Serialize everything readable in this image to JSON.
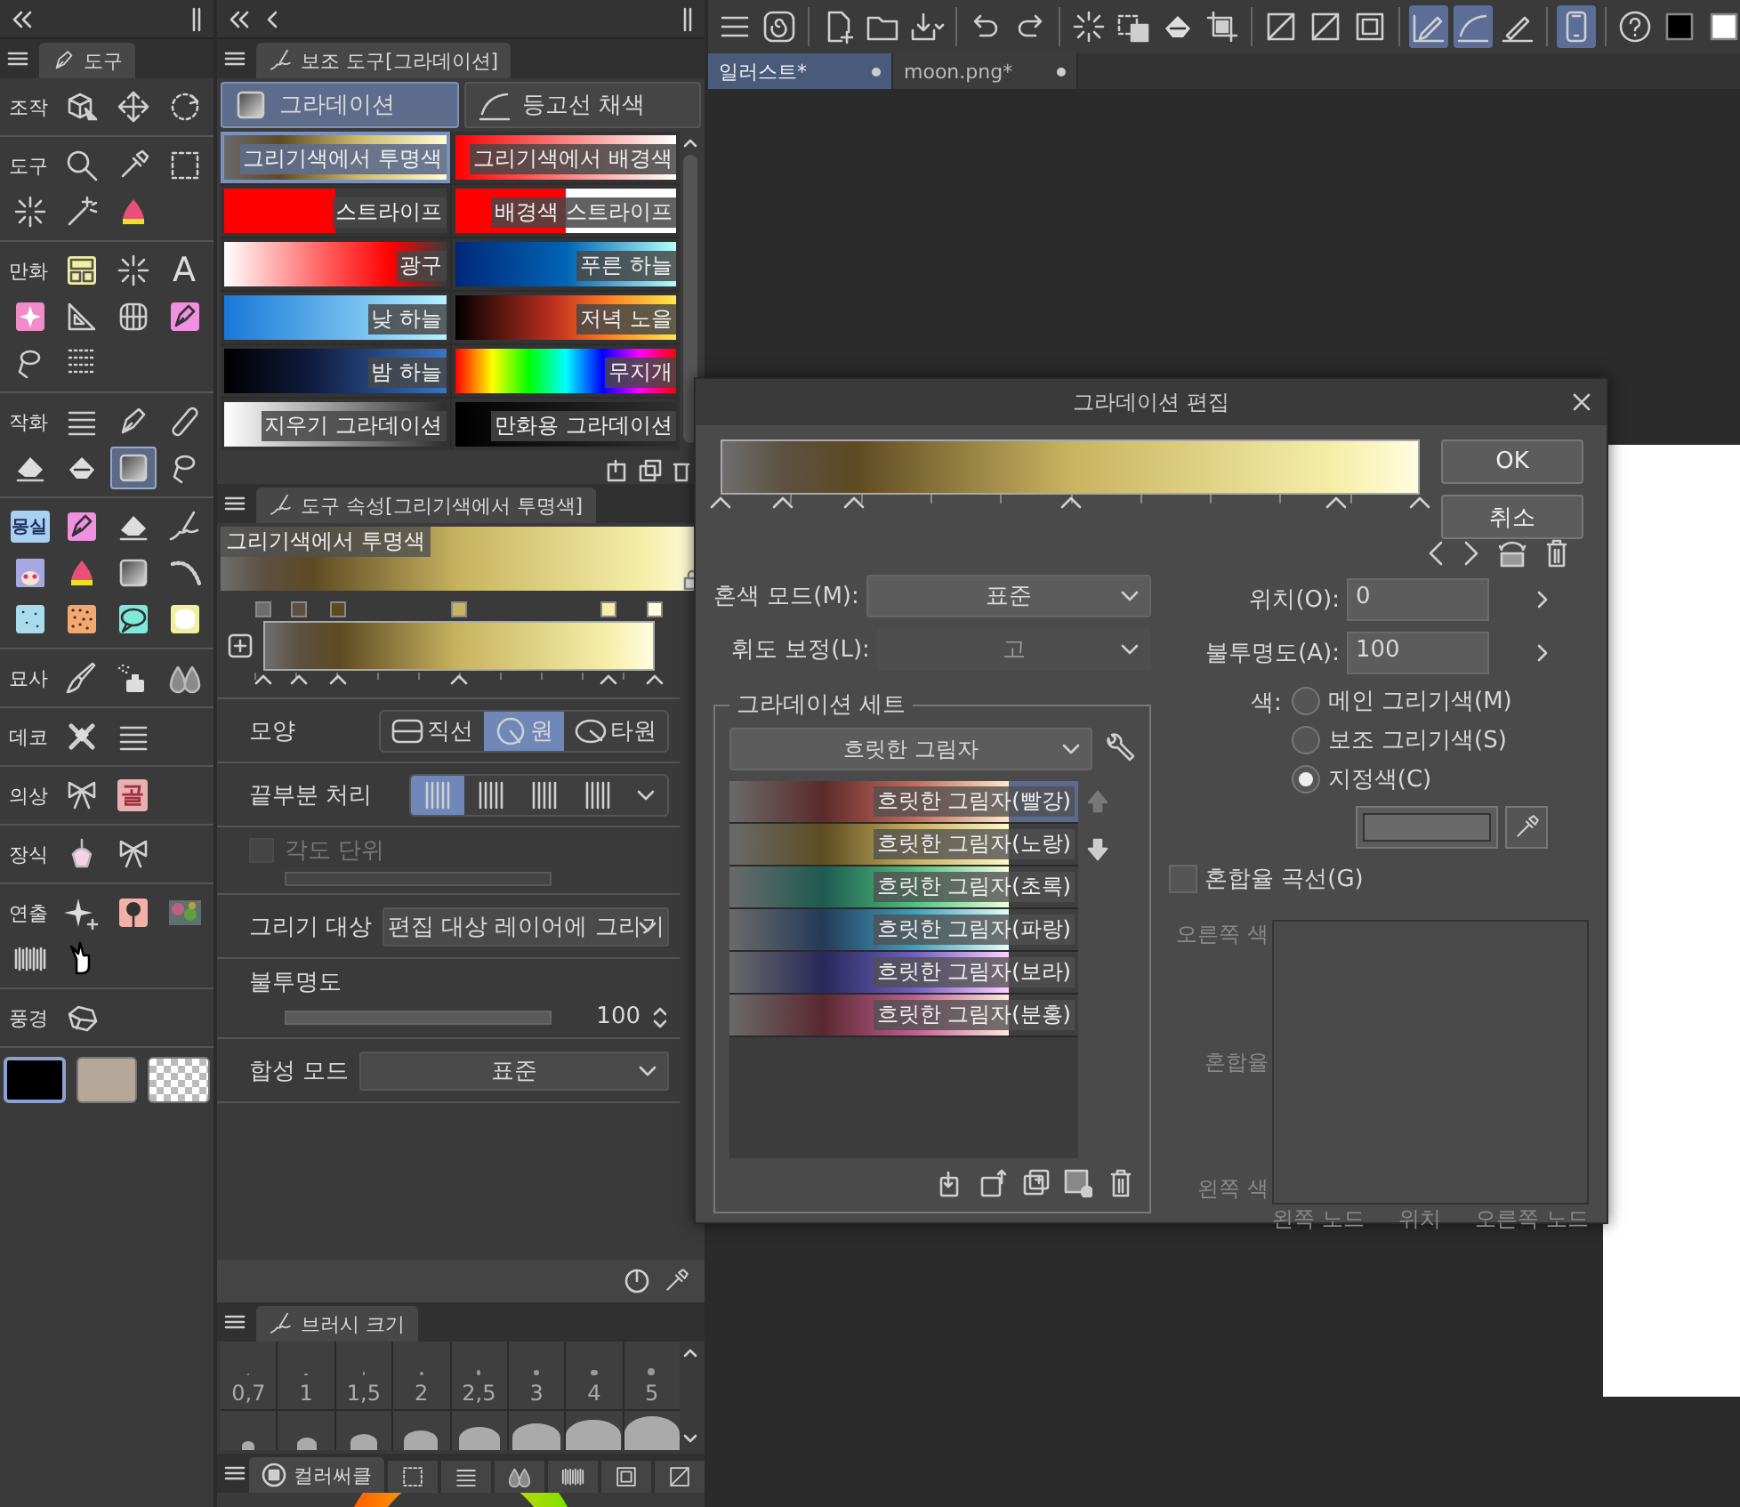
{
  "tool_palette": {
    "tab": "도구",
    "groups": [
      {
        "label": "조작",
        "tools": [
          {
            "selected": false
          },
          {
            "selected": false
          },
          {
            "selected": false
          }
        ]
      },
      {
        "label": "도구",
        "tools": [
          {
            "selected": false
          },
          {
            "selected": false
          },
          {
            "selected": false
          },
          {
            "selected": false
          },
          {
            "selected": false
          },
          {
            "selected": false
          }
        ]
      },
      {
        "label": "만화",
        "tools": [
          {
            "selected": false
          },
          {
            "selected": false
          },
          {
            "selected": false,
            "glyph": "A"
          },
          {
            "selected": false
          },
          {
            "selected": false
          },
          {
            "selected": false
          },
          {
            "selected": false
          },
          {
            "selected": false
          },
          {
            "selected": false
          }
        ]
      },
      {
        "label": "작화",
        "tools": [
          {
            "selected": false
          },
          {
            "selected": false
          },
          {
            "selected": false
          },
          {
            "selected": false
          },
          {
            "selected": false
          },
          {
            "selected": true
          },
          {
            "selected": false
          }
        ]
      },
      {
        "tools": [
          {
            "selected": false,
            "glyph": "몽실"
          },
          {
            "selected": false
          },
          {
            "selected": false
          },
          {
            "selected": false
          },
          {
            "selected": false
          },
          {
            "selected": false
          },
          {
            "selected": false
          },
          {
            "selected": false
          },
          {
            "selected": false
          },
          {
            "selected": false
          },
          {
            "selected": false
          },
          {
            "selected": false
          }
        ]
      },
      {
        "label": "묘사",
        "tools": [
          {
            "selected": false
          },
          {
            "selected": false
          },
          {
            "selected": false
          }
        ]
      },
      {
        "label": "데코",
        "tools": [
          {
            "selected": false
          },
          {
            "selected": false
          }
        ]
      },
      {
        "label": "의상",
        "tools": [
          {
            "selected": false
          },
          {
            "selected": false,
            "glyph": "골"
          }
        ]
      },
      {
        "label": "장식",
        "tools": [
          {
            "selected": false
          },
          {
            "selected": false
          }
        ]
      },
      {
        "label": "연출",
        "tools": [
          {
            "selected": false
          },
          {
            "selected": false
          },
          {
            "selected": false
          },
          {
            "selected": false
          },
          {
            "selected": false
          }
        ]
      },
      {
        "label": "풍경",
        "tools": [
          {
            "selected": false
          }
        ]
      }
    ],
    "colors": [
      {
        "kind": "solid",
        "color": "#000000",
        "selected": true
      },
      {
        "kind": "solid",
        "color": "#b5a898",
        "selected": false
      },
      {
        "kind": "transparent",
        "selected": false
      }
    ]
  },
  "sub_tool": {
    "tab": "보조 도구[그라데이션]",
    "groups": [
      {
        "label": "그라데이션",
        "selected": true
      },
      {
        "label": "등고선 채색",
        "selected": false
      }
    ],
    "items": [
      {
        "name": "그리기색에서 투명색",
        "selected": true
      },
      {
        "name": "그리기색에서 배경색",
        "selected": false
      },
      {
        "name": "스트라이프",
        "selected": false
      },
      {
        "name": "배경색 스트라이프",
        "selected": false
      },
      {
        "name": "광구",
        "selected": false
      },
      {
        "name": "푸른 하늘",
        "selected": false
      },
      {
        "name": "낮 하늘",
        "selected": false
      },
      {
        "name": "저녁 노을",
        "selected": false
      },
      {
        "name": "밤 하늘",
        "selected": false
      },
      {
        "name": "무지개",
        "selected": false
      },
      {
        "name": "지우기 그라데이션",
        "selected": false
      },
      {
        "name": "만화용 그라데이션",
        "selected": false
      }
    ]
  },
  "tool_property": {
    "tab": "도구 속성[그리기색에서 투명색]",
    "preview_label": "그리기색에서 투명색",
    "stops": [
      {
        "color": "#6e6e6e",
        "level": 0
      },
      {
        "color": "#5c5040",
        "level": 0.09
      },
      {
        "color": "#5e4a22",
        "level": 0.19
      },
      {
        "color": "#c8b460",
        "level": 0.5
      },
      {
        "color": "#f6eea8",
        "level": 0.88
      },
      {
        "color": "#fffde0",
        "level": 1
      }
    ],
    "shape": {
      "label": "모양",
      "options": [
        {
          "label": "직선",
          "selected": false
        },
        {
          "label": "원",
          "selected": true
        },
        {
          "label": "타원",
          "selected": false
        }
      ]
    },
    "edge": {
      "label": "끝부분 처리",
      "options": [
        {
          "selected": true
        },
        {
          "selected": false
        },
        {
          "selected": false
        },
        {
          "selected": false
        }
      ]
    },
    "angle_step": {
      "label": "각도 단위",
      "checked": false,
      "disabled": true
    },
    "draw_target": {
      "label": "그리기 대상",
      "value": "편집 대상 레이어에 그리기"
    },
    "opacity": {
      "label": "불투명도",
      "level": 1,
      "value": "100"
    },
    "blend_mode": {
      "label": "합성 모드",
      "value": "표준"
    }
  },
  "brush_size": {
    "tab": "브러시 크기",
    "sizes": [
      "0,7",
      "1",
      "1,5",
      "2",
      "2,5",
      "3",
      "4",
      "5"
    ]
  },
  "color_panel": {
    "tab": "컬러써클"
  },
  "toolbar": {
    "buttons": [
      {
        "on": false
      },
      {
        "on": false
      },
      {
        "on": false
      },
      {
        "on": false
      },
      {
        "on": false
      },
      {
        "on": false
      },
      {
        "on": false
      },
      {
        "on": false
      },
      {
        "on": false
      },
      {
        "on": false
      },
      {
        "on": false
      },
      {
        "on": false
      },
      {
        "on": false
      },
      {
        "on": false
      },
      {
        "on": true
      },
      {
        "on": true
      },
      {
        "on": false
      },
      {
        "on": true
      },
      {
        "on": false
      },
      {
        "on": false
      },
      {
        "on": false
      }
    ]
  },
  "documents": [
    {
      "title": "일러스트*",
      "selected": true
    },
    {
      "title": "moon.png*",
      "selected": false
    }
  ],
  "gradient_editor": {
    "title": "그라데이션 편집",
    "buttons": [
      "OK",
      "취소"
    ],
    "blend_color_mode": {
      "label": "혼색 모드(M):",
      "value": "표준"
    },
    "luminance": {
      "label": "휘도 보정(L):",
      "value": "고",
      "disabled": true
    },
    "gradient_set": {
      "title": "그라데이션 세트",
      "set": "흐릿한 그림자",
      "items": [
        {
          "name": "흐릿한 그림자(빨강)",
          "selected": true
        },
        {
          "name": "흐릿한 그림자(노랑)",
          "selected": false
        },
        {
          "name": "흐릿한 그림자(초록)",
          "selected": false
        },
        {
          "name": "흐릿한 그림자(파랑)",
          "selected": false
        },
        {
          "name": "흐릿한 그림자(보라)",
          "selected": false
        },
        {
          "name": "흐릿한 그림자(분홍)",
          "selected": false
        }
      ],
      "move_buttons": [
        {
          "disabled": true
        },
        {
          "disabled": false
        }
      ]
    },
    "position": {
      "label": "위치(O):",
      "value": "0"
    },
    "opacity": {
      "label": "불투명도(A):",
      "value": "100"
    },
    "color": {
      "label": "색:",
      "options": [
        {
          "label": "메인 그리기색(M)",
          "selected": false
        },
        {
          "label": "보조 그리기색(S)",
          "selected": false
        },
        {
          "label": "지정색(C)",
          "selected": true
        }
      ]
    },
    "curve": {
      "label": "혼합율 곡선(G)",
      "checked": false
    },
    "graph_labels": {
      "right_color": "오른쪽 색",
      "ratio": "혼합율",
      "left_color": "왼쪽 색",
      "left_node": "왼쪽 노드",
      "position": "위치",
      "right_node": "오른쪽 노드"
    }
  }
}
